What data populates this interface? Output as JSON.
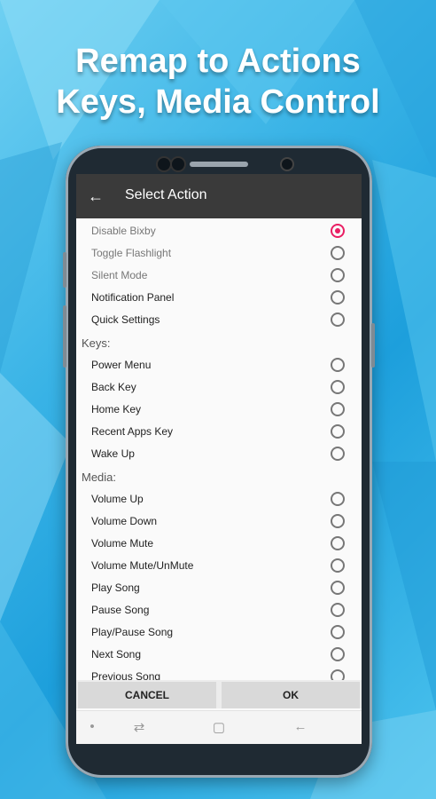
{
  "headline": {
    "line1": "Remap to Actions",
    "line2": "Keys, Media Control"
  },
  "appbar": {
    "back_icon": "arrow-left-icon",
    "title": "Select Action"
  },
  "actions": [
    {
      "label": "Disable Bixby",
      "selected": true,
      "dim": true
    },
    {
      "label": "Toggle Flashlight",
      "selected": false,
      "dim": true
    },
    {
      "label": "Silent Mode",
      "selected": false,
      "dim": true
    },
    {
      "label": "Notification Panel",
      "selected": false
    },
    {
      "label": "Quick Settings",
      "selected": false
    }
  ],
  "keys_header": "Keys:",
  "keys": [
    {
      "label": "Power Menu",
      "selected": false
    },
    {
      "label": "Back Key",
      "selected": false
    },
    {
      "label": "Home Key",
      "selected": false
    },
    {
      "label": "Recent Apps Key",
      "selected": false
    },
    {
      "label": "Wake Up",
      "selected": false
    }
  ],
  "media_header": "Media:",
  "media": [
    {
      "label": "Volume Up",
      "selected": false
    },
    {
      "label": "Volume Down",
      "selected": false
    },
    {
      "label": "Volume Mute",
      "selected": false
    },
    {
      "label": "Volume Mute/UnMute",
      "selected": false
    },
    {
      "label": "Play Song",
      "selected": false
    },
    {
      "label": "Pause Song",
      "selected": false
    },
    {
      "label": "Play/Pause Song",
      "selected": false
    },
    {
      "label": "Next Song",
      "selected": false
    },
    {
      "label": "Previous Song",
      "selected": false
    }
  ],
  "buttons": {
    "cancel": "CANCEL",
    "ok": "OK"
  },
  "navbar": {
    "dot": "•",
    "recents": "⇄",
    "home": "▢",
    "back": "←"
  },
  "colors": {
    "accent": "#e91e63",
    "appbar": "#3a3a3a"
  }
}
